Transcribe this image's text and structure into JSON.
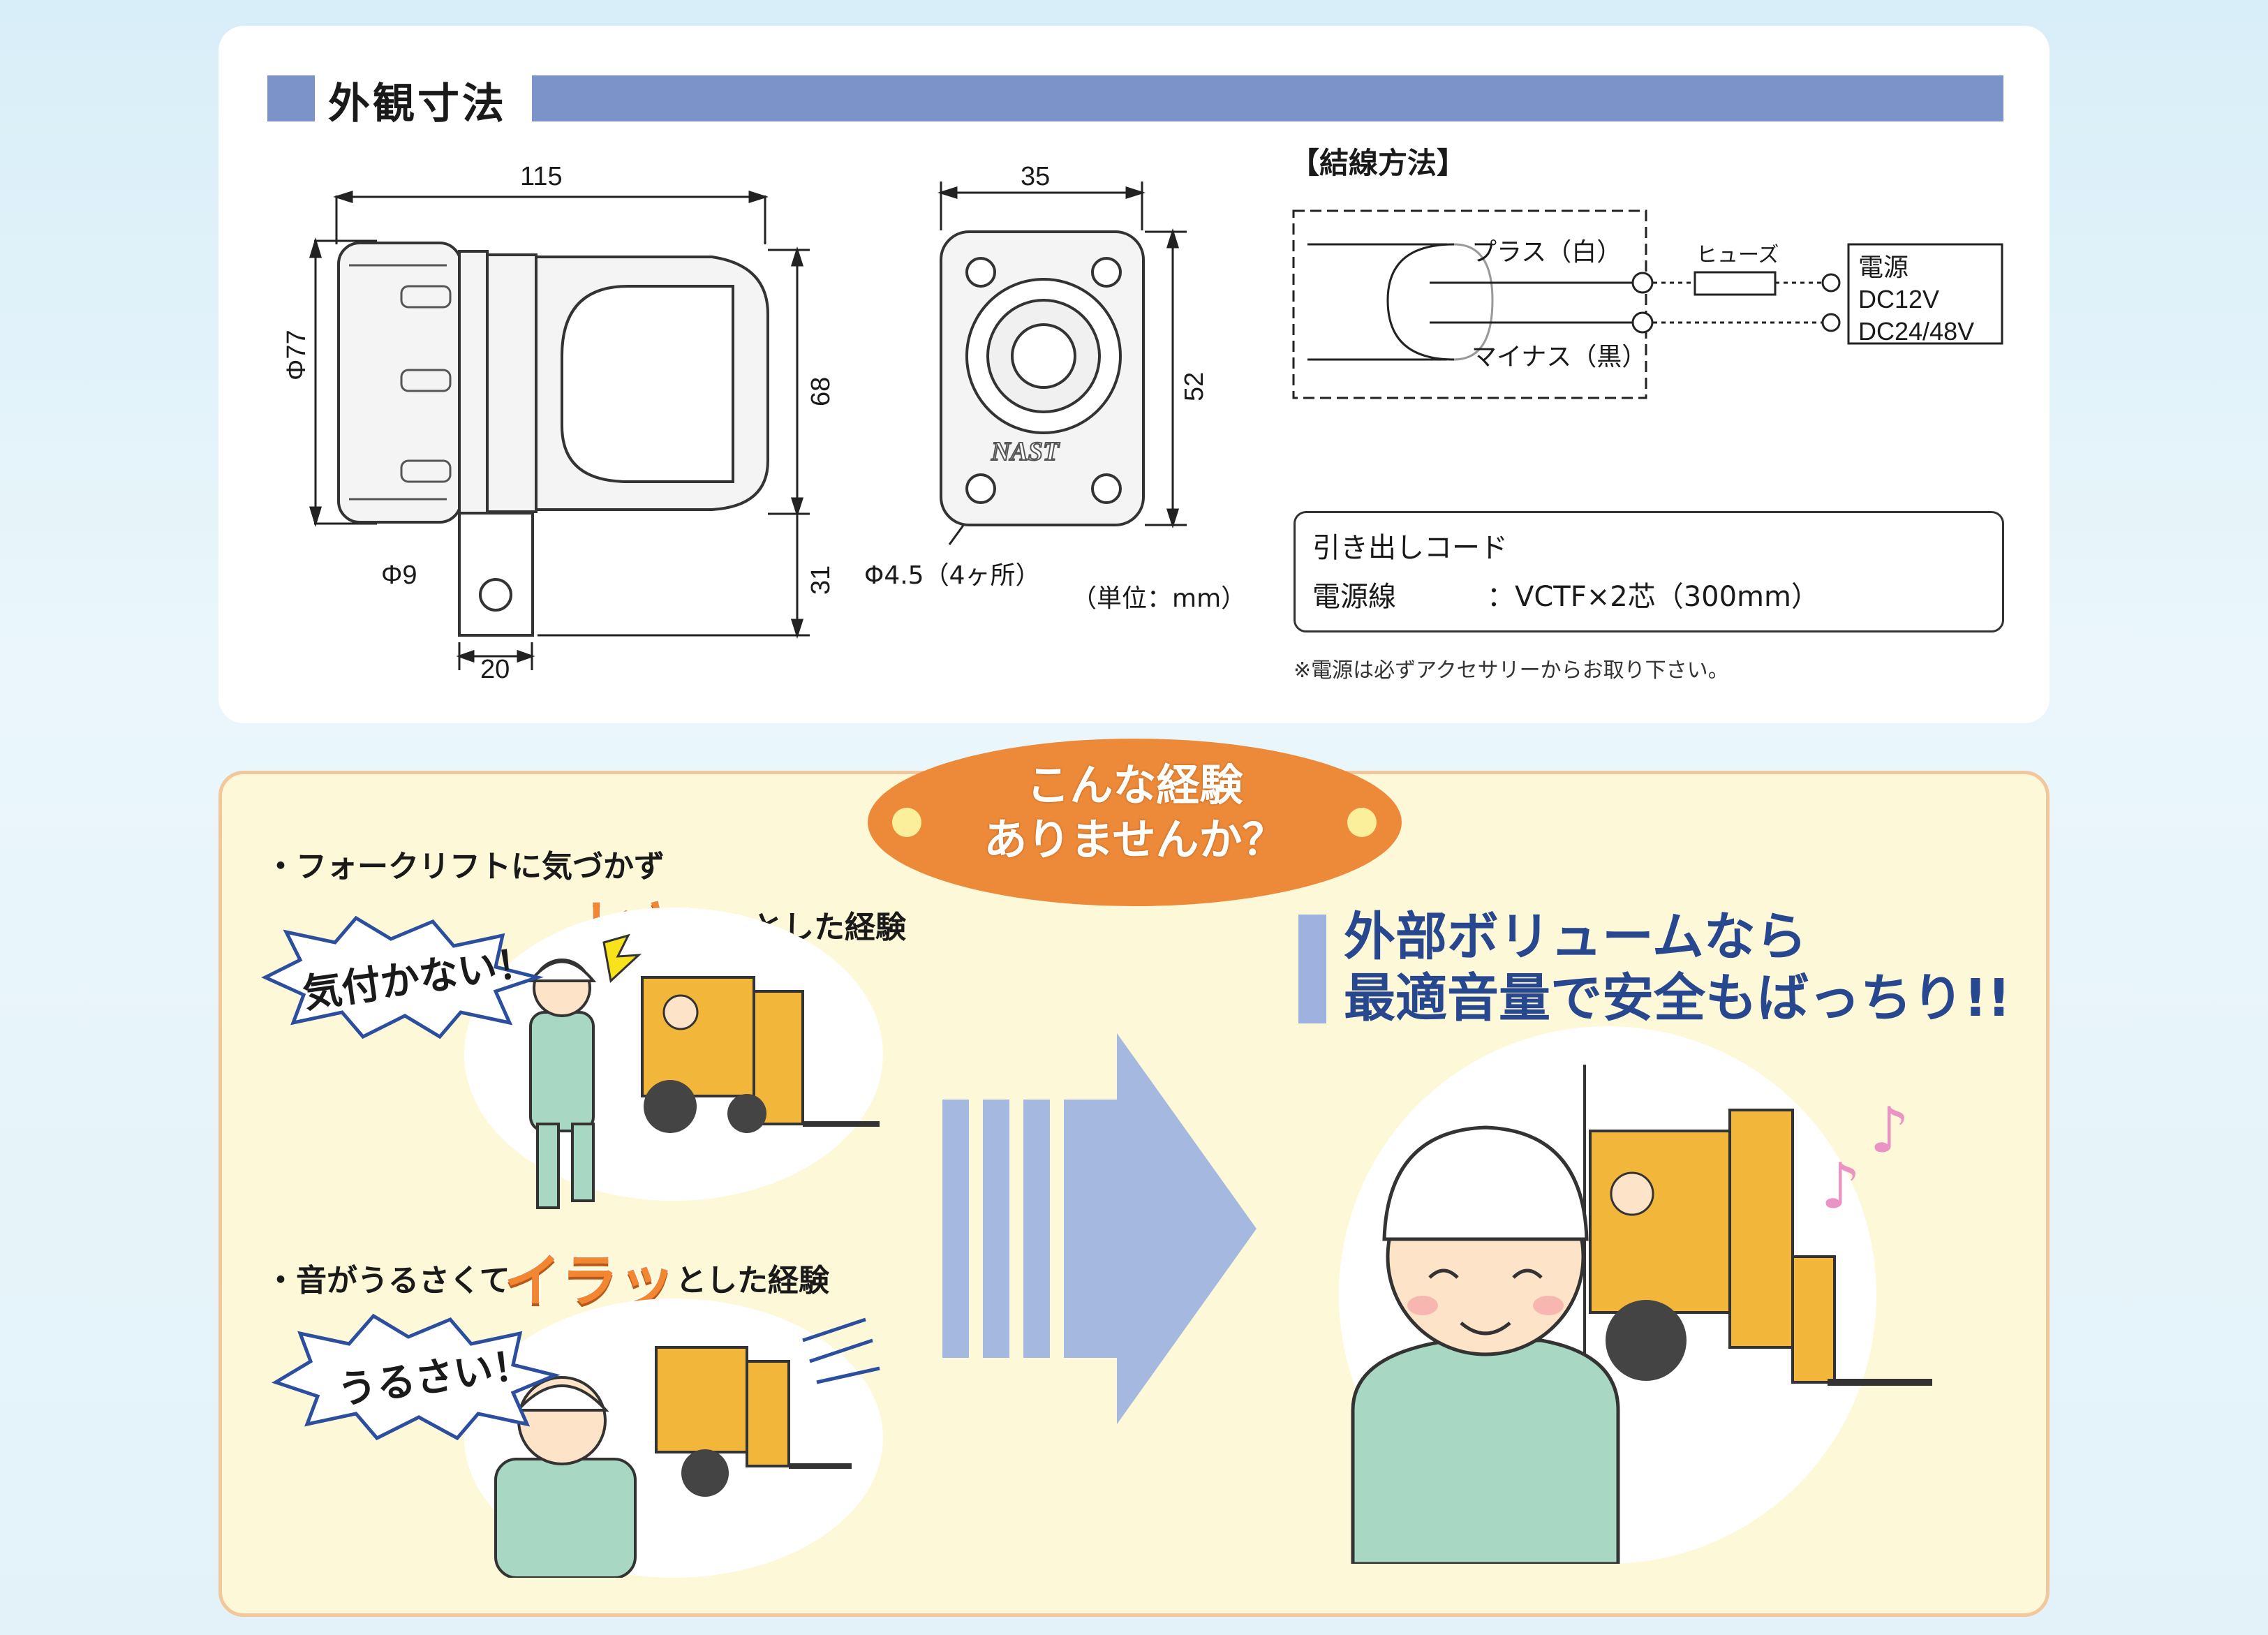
{
  "dimensions": {
    "title": "外観寸法",
    "side_view": {
      "width": "115",
      "diameter": "Φ77",
      "height": "68",
      "bracket_height": "31",
      "hole": "Φ9",
      "bracket_width": "20"
    },
    "front_view": {
      "width": "35",
      "height": "52",
      "mount_hole": "Φ4.5（4ヶ所）",
      "logo": "NAST"
    },
    "unit": "（単位：mm）"
  },
  "wiring": {
    "title": "【結線方法】",
    "plus_label": "プラス（白）",
    "minus_label": "マイナス（黒）",
    "fuse_label": "ヒューズ",
    "power_title": "電源",
    "power_v1": "DC12V",
    "power_v2": "DC24/48V"
  },
  "cord": {
    "title": "引き出しコード",
    "name": "電源線",
    "value": "：VCTF×2芯（300mm）",
    "note": "※電源は必ずアクセサリーからお取り下さい。"
  },
  "experience": {
    "bubble_line1": "こんな経験",
    "bubble_line2": "ありませんか？",
    "case1_text": "・フォークリフトに気づかず",
    "case1_exclaim": "ヒヤッ",
    "case1_tail": "とした経験",
    "case1_shout": "気付かない！",
    "case2_text": "・音がうるさくて",
    "case2_exclaim": "イラッ",
    "case2_tail": "とした経験",
    "case2_shout": "うるさい！",
    "solution_line1": "外部ボリュームなら",
    "solution_line2": "最適音量で安全もばっちり!!"
  },
  "colors": {
    "accent_blue": "#7b93c9",
    "orange": "#ec8a3a",
    "panel_border": "#f3c79c",
    "forklift_yellow": "#f2b73a",
    "worker_green": "#a8d8c4"
  }
}
